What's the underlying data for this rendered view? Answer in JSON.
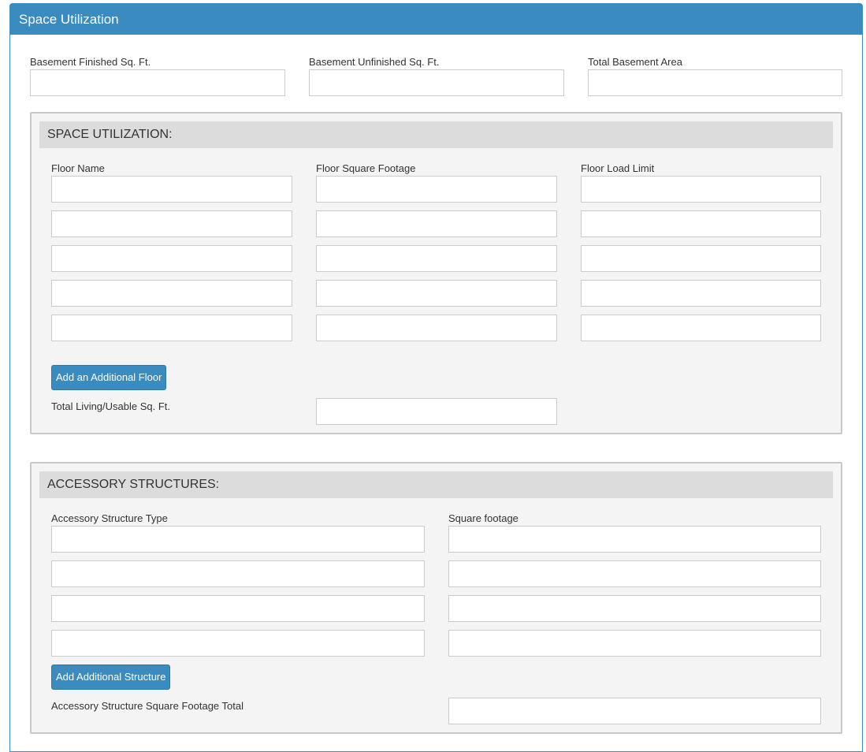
{
  "panel": {
    "title": "Space Utilization"
  },
  "basement": {
    "finished_label": "Basement Finished Sq. Ft.",
    "unfinished_label": "Basement Unfinished Sq. Ft.",
    "total_label": "Total Basement Area",
    "finished_value": "",
    "unfinished_value": "",
    "total_value": ""
  },
  "space_utilization": {
    "title": "SPACE UTILIZATION:",
    "col_floor_name": "Floor Name",
    "col_floor_sqft": "Floor Square Footage",
    "col_floor_load": "Floor Load Limit",
    "rows": [
      {
        "name": "",
        "sqft": "",
        "load": ""
      },
      {
        "name": "",
        "sqft": "",
        "load": ""
      },
      {
        "name": "",
        "sqft": "",
        "load": ""
      },
      {
        "name": "",
        "sqft": "",
        "load": ""
      },
      {
        "name": "",
        "sqft": "",
        "load": ""
      }
    ],
    "add_button": "Add an Additional Floor",
    "total_label": "Total Living/Usable Sq. Ft.",
    "total_value": ""
  },
  "accessory": {
    "title": "ACCESSORY STRUCTURES:",
    "col_type": "Accessory Structure Type",
    "col_sqft": "Square footage",
    "rows": [
      {
        "type": "",
        "sqft": ""
      },
      {
        "type": "",
        "sqft": ""
      },
      {
        "type": "",
        "sqft": ""
      },
      {
        "type": "",
        "sqft": ""
      }
    ],
    "add_button": "Add Additional Structure",
    "total_label": "Accessory Structure Square Footage Total",
    "total_value": ""
  },
  "colors": {
    "accent": "#3a8bbf",
    "box_bg": "#f4f4f4",
    "box_title_bg": "#dcdcdc"
  }
}
